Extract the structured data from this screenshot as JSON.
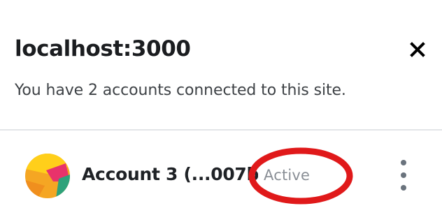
{
  "header": {
    "site": "localhost:3000",
    "close_icon": "close-icon"
  },
  "subtitle": "You have 2 accounts connected to this site.",
  "accounts": [
    {
      "name": "Account 3 (...007b",
      "status": "Active",
      "avatar_colors": [
        "#f5a623",
        "#ffcf1a",
        "#e8336b",
        "#2ea27a"
      ],
      "menu_icon": "vertical-dots-icon",
      "highlight_color": "#e0191a"
    }
  ]
}
